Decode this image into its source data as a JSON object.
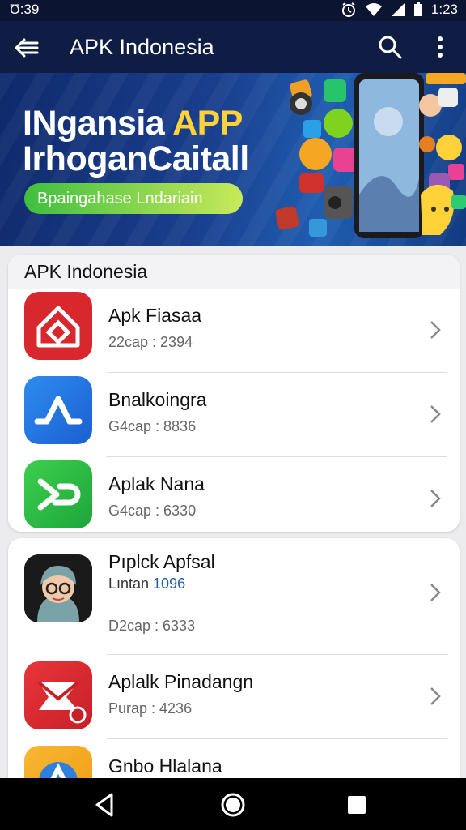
{
  "status_bar": {
    "time": "Ʊ:39",
    "clock": "1:23"
  },
  "app_bar": {
    "title": "APK Indonesia"
  },
  "banner": {
    "line1_main": "INgansia ",
    "line1_accent": "APP",
    "line2": "IrhoganCaitall",
    "pill": "Bpaingahase Lndariain"
  },
  "section1": {
    "header": "APK Indonesia",
    "items": [
      {
        "name": "Apk Fiasaa",
        "meta": "22cap : 2394"
      },
      {
        "name": "Bnalkoingra",
        "meta": "G4cap : 8836"
      },
      {
        "name": "Aplak Nana",
        "meta": "G4cap : 6330"
      }
    ]
  },
  "section2": {
    "items": [
      {
        "name": "Pıplck Apfsal",
        "extra_label": "Lıntan ",
        "extra_num": "1096",
        "meta": "D2cap : 6333"
      },
      {
        "name": "Aplalk Pinadangn",
        "meta": "Purap : 4236"
      },
      {
        "name": "Gnbo Hlalana"
      }
    ]
  },
  "colors": {
    "app_bar": "#0f1d45",
    "accent_yellow": "#ffd23a",
    "pill_green": "#3fbf3f"
  }
}
